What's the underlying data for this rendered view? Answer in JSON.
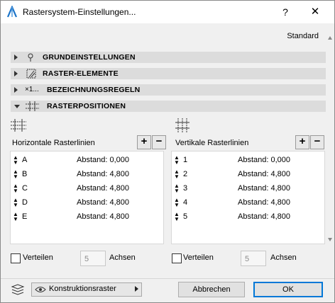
{
  "window": {
    "title": "Rastersystem-Einstellungen...",
    "help_label": "?",
    "close_label": "✕"
  },
  "profile_label": "Standard",
  "sections": [
    {
      "label": "GRUNDEINSTELLUNGEN",
      "expanded": false,
      "icon": "pin-icon"
    },
    {
      "label": "RASTER-ELEMENTE",
      "expanded": false,
      "icon": "grid-element-icon"
    },
    {
      "label": "BEZEICHNUNGSREGELN",
      "expanded": false,
      "icon": "naming-icon",
      "icon_text": "×1..."
    },
    {
      "label": "RASTERPOSITIONEN",
      "expanded": true,
      "icon": "grid-positions-icon"
    }
  ],
  "horizontal": {
    "title": "Horizontale Rasterlinien",
    "add_label": "+",
    "remove_label": "−",
    "rows": [
      {
        "name": "A",
        "value": "Abstand: 0,000"
      },
      {
        "name": "B",
        "value": "Abstand: 4,800"
      },
      {
        "name": "C",
        "value": "Abstand: 4,800"
      },
      {
        "name": "D",
        "value": "Abstand: 4,800"
      },
      {
        "name": "E",
        "value": "Abstand: 4,800"
      }
    ],
    "distribute_label": "Verteilen",
    "distribute_checked": false,
    "axes_value": "5",
    "axes_label": "Achsen"
  },
  "vertical": {
    "title": "Vertikale Rasterlinien",
    "add_label": "+",
    "remove_label": "−",
    "rows": [
      {
        "name": "1",
        "value": "Abstand: 0,000"
      },
      {
        "name": "2",
        "value": "Abstand: 4,800"
      },
      {
        "name": "3",
        "value": "Abstand: 4,800"
      },
      {
        "name": "4",
        "value": "Abstand: 4,800"
      },
      {
        "name": "5",
        "value": "Abstand: 4,800"
      }
    ],
    "distribute_label": "Verteilen",
    "distribute_checked": false,
    "axes_value": "5",
    "axes_label": "Achsen"
  },
  "footer": {
    "layer_label": "Konstruktionsraster",
    "cancel_label": "Abbrechen",
    "ok_label": "OK"
  },
  "colors": {
    "accent": "#0078d7",
    "section_bg": "#dcdcdc",
    "dialog_bg": "#f0f0f0"
  }
}
